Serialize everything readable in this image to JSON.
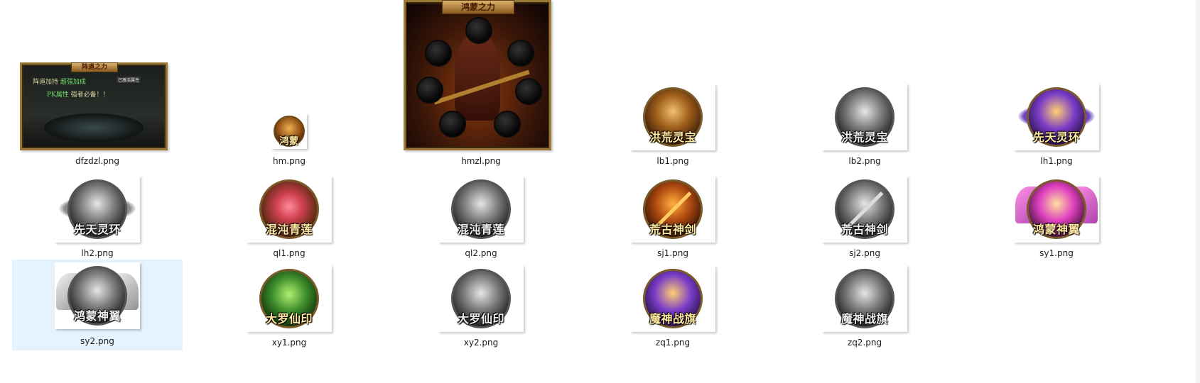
{
  "files": [
    {
      "name": "dfzdzl.png"
    },
    {
      "name": "hm.png"
    },
    {
      "name": "hmzl.png"
    },
    {
      "name": "lb1.png"
    },
    {
      "name": "lb2.png"
    },
    {
      "name": "lh1.png"
    },
    {
      "name": "lh2.png"
    },
    {
      "name": "ql1.png"
    },
    {
      "name": "ql2.png"
    },
    {
      "name": "sj1.png"
    },
    {
      "name": "sj2.png"
    },
    {
      "name": "sy1.png"
    },
    {
      "name": "sy2.png"
    },
    {
      "name": "xy1.png"
    },
    {
      "name": "xy2.png"
    },
    {
      "name": "zq1.png"
    },
    {
      "name": "zq2.png"
    }
  ],
  "thumb_text": {
    "dfzdzl_title": "阵道之力",
    "dfzdzl_line1a": "阵道加持",
    "dfzdzl_line1b": "超强加成",
    "dfzdzl_tab": "已激活属性",
    "dfzdzl_line2a": "PK属性",
    "dfzdzl_line2b": "强者必备！！",
    "hm_label": "鸿蒙",
    "hmzl_title": "鸿蒙之力",
    "lb1_label": "洪荒灵宝",
    "lb2_label": "洪荒灵宝",
    "lh1_label": "先天灵环",
    "lh2_label": "先天灵环",
    "ql1_label": "混沌青莲",
    "ql2_label": "混沌青莲",
    "sj1_label": "荒古神剑",
    "sj2_label": "荒古神剑",
    "sy1_label": "鸿蒙神翼",
    "sy2_label": "鸿蒙神翼",
    "xy1_label": "大罗仙印",
    "xy2_label": "大罗仙印",
    "zq1_label": "魔神战旗",
    "zq2_label": "魔神战旗"
  },
  "colors": {
    "selection_bg": "#e5f3ff",
    "caption_text": "#1a1a1a"
  },
  "selected_file": "sy2.png"
}
